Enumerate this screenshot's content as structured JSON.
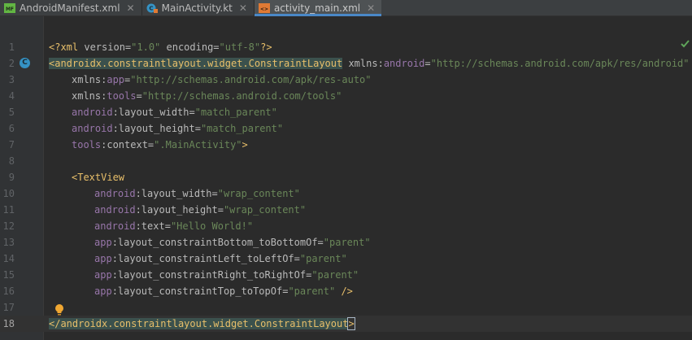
{
  "tabs": [
    {
      "label": "AndroidManifest.xml",
      "icon": "manifest-file-icon",
      "active": false,
      "close": "✕"
    },
    {
      "label": "MainActivity.kt",
      "icon": "kotlin-class-icon",
      "active": false,
      "close": "✕"
    },
    {
      "label": "activity_main.xml",
      "icon": "xml-layout-file-icon",
      "active": true,
      "close": "✕"
    }
  ],
  "editor": {
    "current_line": 18,
    "status_icon": "check-icon",
    "gutter_marker_line": 2,
    "gutter_marker_letter": "C",
    "colors": {
      "background": "#2b2b2b",
      "gutter": "#313335",
      "tag": "#e8bf6a",
      "namespace": "#9876aa",
      "value": "#6a8759",
      "attribute": "#bababa",
      "tab_underline": "#4a88c7"
    },
    "lines": [
      {
        "n": "1",
        "indent": 0,
        "tokens": [
          [
            "pi",
            "<?xml "
          ],
          [
            "attr",
            "version="
          ],
          [
            "val",
            "\"1.0\""
          ],
          [
            "attr",
            " encoding="
          ],
          [
            "val",
            "\"utf-8\""
          ],
          [
            "pi",
            "?>"
          ]
        ]
      },
      {
        "n": "2",
        "indent": 0,
        "tokens": [
          [
            "taghl",
            "<androidx.constraintlayout.widget.ConstraintLayout"
          ],
          [
            "attr",
            " xmlns:"
          ],
          [
            "ns",
            "android"
          ],
          [
            "attr",
            "="
          ],
          [
            "val",
            "\"http://schemas.android.com/apk/res/android\""
          ]
        ]
      },
      {
        "n": "3",
        "indent": 1,
        "tokens": [
          [
            "attr",
            "xmlns:"
          ],
          [
            "ns",
            "app"
          ],
          [
            "attr",
            "="
          ],
          [
            "val",
            "\"http://schemas.android.com/apk/res-auto\""
          ]
        ]
      },
      {
        "n": "4",
        "indent": 1,
        "tokens": [
          [
            "attr",
            "xmlns:"
          ],
          [
            "ns",
            "tools"
          ],
          [
            "attr",
            "="
          ],
          [
            "val",
            "\"http://schemas.android.com/tools\""
          ]
        ]
      },
      {
        "n": "5",
        "indent": 1,
        "tokens": [
          [
            "ns",
            "android"
          ],
          [
            "attr",
            ":layout_width="
          ],
          [
            "val",
            "\"match_parent\""
          ]
        ]
      },
      {
        "n": "6",
        "indent": 1,
        "tokens": [
          [
            "ns",
            "android"
          ],
          [
            "attr",
            ":layout_height="
          ],
          [
            "val",
            "\"match_parent\""
          ]
        ]
      },
      {
        "n": "7",
        "indent": 1,
        "tokens": [
          [
            "ns",
            "tools"
          ],
          [
            "attr",
            ":context="
          ],
          [
            "val",
            "\".MainActivity\""
          ],
          [
            "tag",
            ">"
          ]
        ]
      },
      {
        "n": "8",
        "indent": 0,
        "tokens": []
      },
      {
        "n": "9",
        "indent": 1,
        "tokens": [
          [
            "tag",
            "<TextView"
          ]
        ]
      },
      {
        "n": "10",
        "indent": 2,
        "tokens": [
          [
            "ns",
            "android"
          ],
          [
            "attr",
            ":layout_width="
          ],
          [
            "val",
            "\"wrap_content\""
          ]
        ]
      },
      {
        "n": "11",
        "indent": 2,
        "tokens": [
          [
            "ns",
            "android"
          ],
          [
            "attr",
            ":layout_height="
          ],
          [
            "val",
            "\"wrap_content\""
          ]
        ]
      },
      {
        "n": "12",
        "indent": 2,
        "tokens": [
          [
            "ns",
            "android"
          ],
          [
            "attr",
            ":text="
          ],
          [
            "val",
            "\"Hello World!\""
          ]
        ]
      },
      {
        "n": "13",
        "indent": 2,
        "tokens": [
          [
            "ns",
            "app"
          ],
          [
            "attr",
            ":layout_constraintBottom_toBottomOf="
          ],
          [
            "val",
            "\"parent\""
          ]
        ]
      },
      {
        "n": "14",
        "indent": 2,
        "tokens": [
          [
            "ns",
            "app"
          ],
          [
            "attr",
            ":layout_constraintLeft_toLeftOf="
          ],
          [
            "val",
            "\"parent\""
          ]
        ]
      },
      {
        "n": "15",
        "indent": 2,
        "tokens": [
          [
            "ns",
            "app"
          ],
          [
            "attr",
            ":layout_constraintRight_toRightOf="
          ],
          [
            "val",
            "\"parent\""
          ]
        ]
      },
      {
        "n": "16",
        "indent": 2,
        "tokens": [
          [
            "ns",
            "app"
          ],
          [
            "attr",
            ":layout_constraintTop_toTopOf="
          ],
          [
            "val",
            "\"parent\""
          ],
          [
            "tag",
            " />"
          ]
        ]
      },
      {
        "n": "17",
        "indent": 0,
        "tokens": []
      },
      {
        "n": "18",
        "indent": 0,
        "tokens": [
          [
            "taghl",
            "</androidx.constraintlayout.widget.ConstraintLayout"
          ],
          [
            "tagbr",
            ">"
          ]
        ]
      }
    ]
  }
}
